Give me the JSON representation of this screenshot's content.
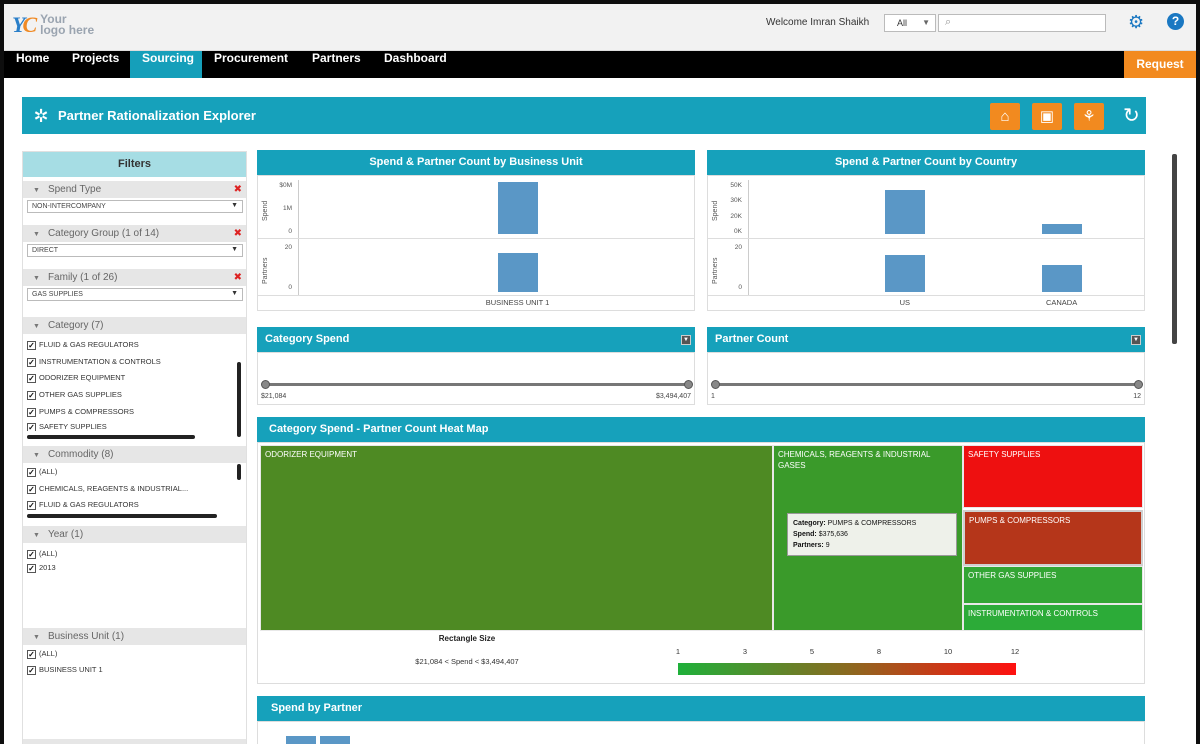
{
  "header": {
    "logo_mark": "YC",
    "logo_line1": "Your",
    "logo_line2": "logo here",
    "welcome": "Welcome Imran Shaikh",
    "scope_value": "All",
    "search_placeholder": "",
    "help_label": "?"
  },
  "nav": {
    "items": [
      "Home",
      "Projects",
      "Sourcing",
      "Procurement",
      "Partners",
      "Dashboard"
    ],
    "active": "Sourcing",
    "request_label": "Request"
  },
  "page": {
    "title": "Partner Rationalization Explorer"
  },
  "filters": {
    "title": "Filters",
    "spend_type": {
      "label": "Spend Type",
      "value": "NON-INTERCOMPANY"
    },
    "category_group": {
      "label": "Category Group (1 of 14)",
      "value": "DIRECT"
    },
    "family": {
      "label": "Family (1 of 26)",
      "value": "GAS SUPPLIES"
    },
    "category": {
      "label": "Category (7)",
      "items": [
        "FLUID & GAS REGULATORS",
        "INSTRUMENTATION & CONTROLS",
        "ODORIZER EQUIPMENT",
        "OTHER GAS SUPPLIES",
        "PUMPS & COMPRESSORS",
        "SAFETY SUPPLIES"
      ]
    },
    "commodity": {
      "label": "Commodity (8)",
      "items": [
        "(All)",
        "CHEMICALS, REAGENTS & INDUSTRIAL...",
        "FLUID & GAS REGULATORS"
      ]
    },
    "year": {
      "label": "Year (1)",
      "items": [
        "(All)",
        "2013"
      ]
    },
    "business_unit": {
      "label": "Business Unit (1)",
      "items": [
        "(All)",
        "BUSINESS UNIT 1"
      ]
    }
  },
  "chart_data": [
    {
      "type": "bar",
      "title": "Spend & Partner Count by Business Unit",
      "categories": [
        "BUSINESS UNIT 1"
      ],
      "series": [
        {
          "name": "Spend",
          "values": [
            560000
          ]
        },
        {
          "name": "Partners",
          "values": [
            23
          ]
        }
      ],
      "ylabels": [
        "Spend",
        "Partners"
      ],
      "spend_ticks": [
        "0",
        "1M",
        "$0M"
      ],
      "partner_ticks": [
        "0",
        "20"
      ]
    },
    {
      "type": "bar",
      "title": "Spend & Partner Count by Country",
      "categories": [
        "US",
        "CANADA"
      ],
      "series": [
        {
          "name": "Spend",
          "values": [
            510000,
            110000
          ]
        },
        {
          "name": "Partners",
          "values": [
            22,
            16
          ]
        }
      ],
      "ylabels": [
        "Spend",
        "Partners"
      ],
      "spend_ticks": [
        "0K",
        "20K",
        "30K",
        "50K"
      ],
      "partner_ticks": [
        "0",
        "20"
      ]
    },
    {
      "type": "heatmap",
      "title": "Category Spend - Partner Count Heat Map",
      "cells": [
        {
          "label": "ODORIZER EQUIPMENT",
          "color": "#4e8a23"
        },
        {
          "label": "CHEMICALS, REAGENTS & INDUSTRIAL GASES",
          "color": "#3a9a2a"
        },
        {
          "label": "SAFETY SUPPLIES",
          "color": "#ee1010"
        },
        {
          "label": "PUMPS & COMPRESSORS",
          "color": "#b5361a"
        },
        {
          "label": "OTHER GAS SUPPLIES",
          "color": "#33a534"
        },
        {
          "label": "INSTRUMENTATION & CONTROLS",
          "color": "#2cab38"
        }
      ],
      "legend_ticks": [
        "1",
        "3",
        "5",
        "8",
        "10",
        "12"
      ]
    }
  ],
  "tooltip": {
    "category_label": "Category:",
    "category_value": "PUMPS & COMPRESSORS",
    "spend_label": "Spend:",
    "spend_value": "$375,636",
    "partners_label": "Partners:",
    "partners_value": "9"
  },
  "category_spend": {
    "title": "Category Spend",
    "min": "$21,084",
    "max": "$3,494,407"
  },
  "partner_count": {
    "title": "Partner Count",
    "min": "1",
    "max": "12"
  },
  "heatmap_legend": {
    "size_title": "Rectangle Size",
    "size_range": "$21,084 < Spend < $3,494,407"
  },
  "spend_by_partner": {
    "title": "Spend by Partner"
  }
}
